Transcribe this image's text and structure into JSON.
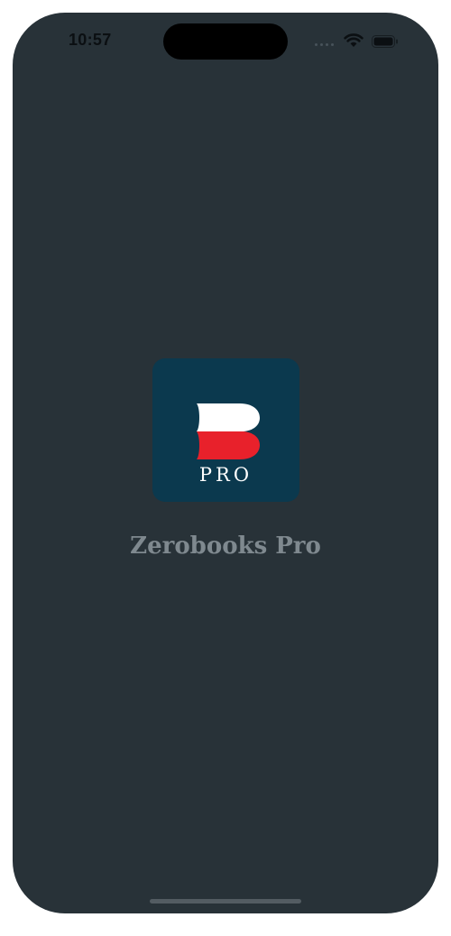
{
  "status_bar": {
    "time": "10:57",
    "icons": [
      "cellular-signal-icon",
      "wifi-icon",
      "battery-icon"
    ]
  },
  "splash": {
    "logo": {
      "badge_text": "PRO",
      "colors": {
        "background": "#0b394e",
        "top_stripe": "#ffffff",
        "bottom_stripe": "#e8212b"
      }
    },
    "app_name": "Zerobooks Pro"
  },
  "colors": {
    "screen_background": "#283238",
    "app_name_text": "#7f898f"
  }
}
